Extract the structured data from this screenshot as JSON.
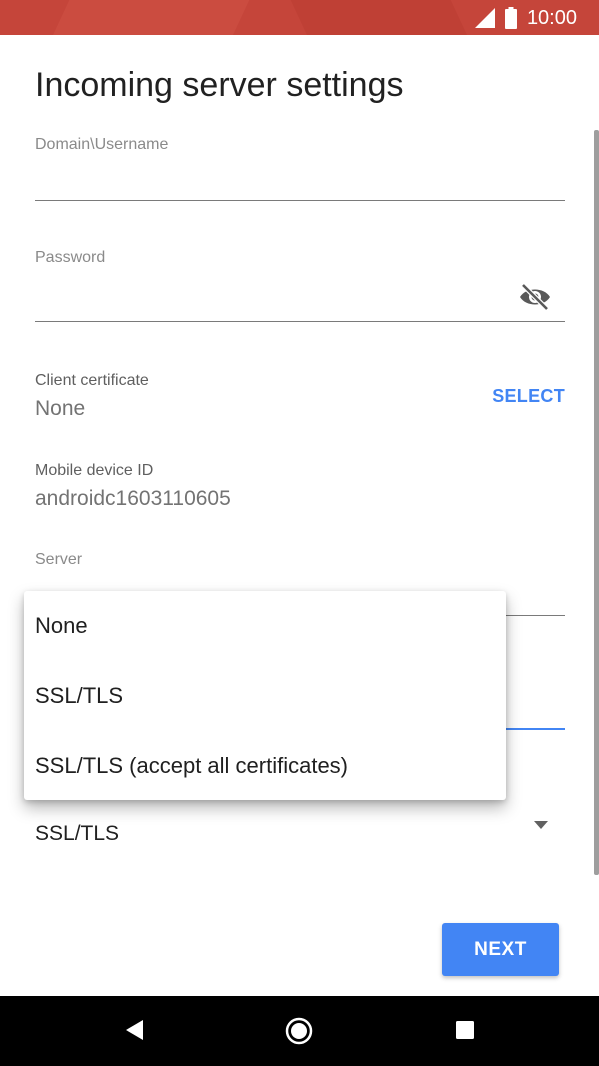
{
  "status_bar": {
    "time": "10:00",
    "icons": [
      "signal-icon",
      "battery-icon"
    ],
    "color": "#c5453a"
  },
  "page": {
    "title": "Incoming server settings"
  },
  "fields": {
    "username": {
      "label": "Domain\\Username",
      "value": ""
    },
    "password": {
      "label": "Password",
      "value": "",
      "toggle_icon": "visibility-off-icon"
    },
    "client_certificate": {
      "label": "Client certificate",
      "value": "None",
      "action_label": "SELECT"
    },
    "mobile_device_id": {
      "label": "Mobile device ID",
      "value": "androidc1603110605"
    },
    "server": {
      "label": "Server",
      "value": ""
    },
    "security_type": {
      "value": "SSL/TLS",
      "icon": "dropdown-arrow-icon"
    }
  },
  "menu": {
    "options": [
      "None",
      "SSL/TLS",
      "SSL/TLS (accept all certificates)"
    ]
  },
  "actions": {
    "next_label": "NEXT"
  },
  "accent_color": "#4285f4",
  "nav_bar": {
    "icons": [
      "back-icon",
      "home-icon",
      "recents-icon"
    ]
  }
}
